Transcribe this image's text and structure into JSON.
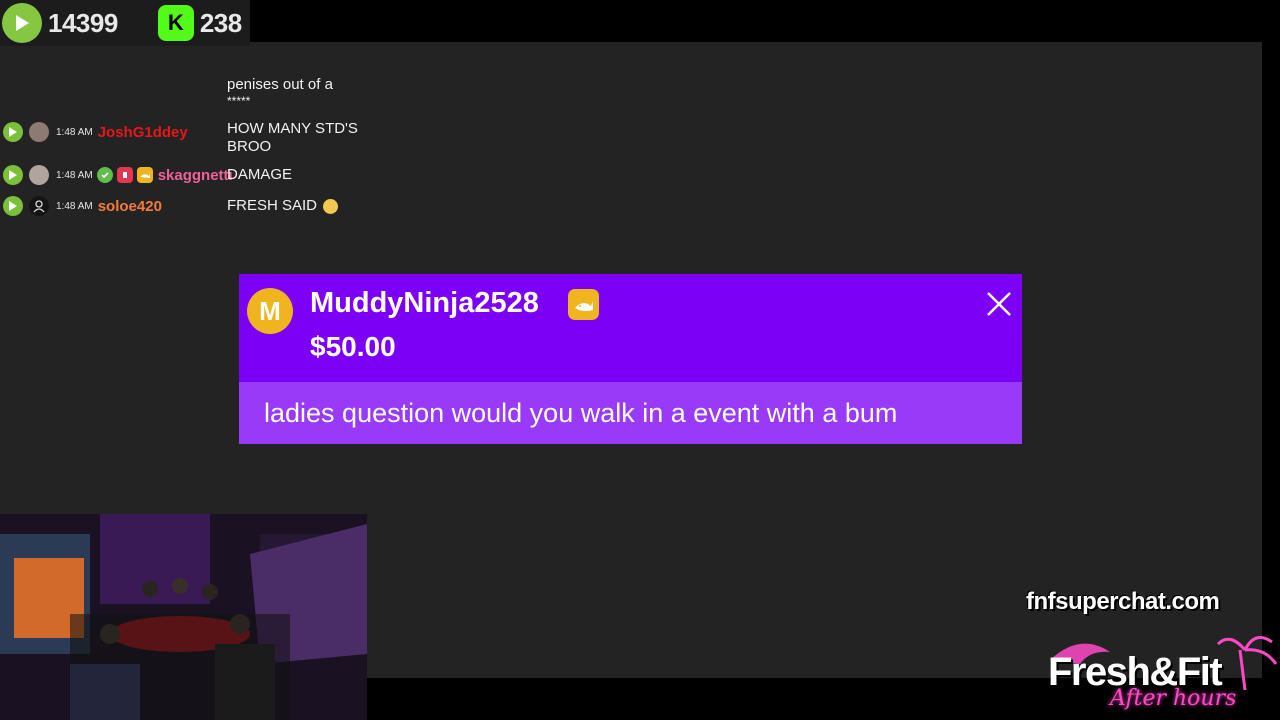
{
  "counters": {
    "rumble_count": "14399",
    "kick_count": "238",
    "kick_letter": "K"
  },
  "chat": {
    "partial_message_lines": [
      "penises out of a",
      "*****"
    ],
    "messages": [
      {
        "time": "1:48 AM",
        "user": "JoshG1ddey",
        "user_color": "#e5171b",
        "text": [
          "HOW MANY STD'S",
          "BROO"
        ]
      },
      {
        "time": "1:48 AM",
        "user": "skaggnetti",
        "user_color": "#f0609a",
        "text": [
          "DAMAGE"
        ]
      },
      {
        "time": "1:48 AM",
        "user": "soloe420",
        "user_color": "#f47b3c",
        "text": [
          "FRESH SAID"
        ]
      }
    ]
  },
  "superchat": {
    "avatar_letter": "M",
    "username": "MuddyNinja2528",
    "amount": "$50.00",
    "message": "ladies question would you walk in a event with a bum",
    "colors": {
      "header": "#7c00f6",
      "body": "#9a3af9",
      "avatar": "#f0b41e"
    }
  },
  "branding": {
    "site": "fnfsuperchat.com",
    "brand_main": "Fresh&Fit",
    "brand_sub": "After hours"
  }
}
